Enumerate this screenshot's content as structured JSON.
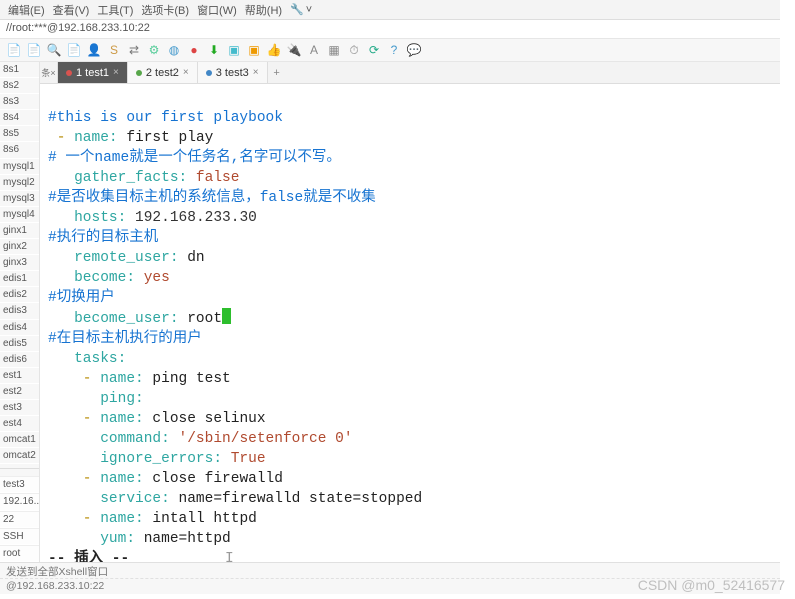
{
  "menubar": {
    "items": [
      "编辑(E)",
      "查看(V)",
      "工具(T)",
      "选项卡(B)",
      "窗口(W)",
      "帮助(H)"
    ],
    "wrench": "˅"
  },
  "address": "//root:***@192.168.233.10:22",
  "toolbar_icons": [
    {
      "name": "file",
      "g": "📄",
      "c": "#5a5"
    },
    {
      "name": "doc",
      "g": "📄",
      "c": "#888"
    },
    {
      "name": "search",
      "g": "🔍",
      "c": "#888"
    },
    {
      "name": "doc2",
      "g": "📄",
      "c": "#888"
    },
    {
      "name": "user",
      "g": "👤",
      "c": "#f39c12"
    },
    {
      "name": "script",
      "g": "S",
      "c": "#c94"
    },
    {
      "name": "arrows",
      "g": "⇄",
      "c": "#777"
    },
    {
      "name": "gear",
      "g": "⚙",
      "c": "#5c9"
    },
    {
      "name": "node",
      "g": "◍",
      "c": "#49c"
    },
    {
      "name": "red",
      "g": "●",
      "c": "#d44"
    },
    {
      "name": "dl",
      "g": "⬇",
      "c": "#2a2"
    },
    {
      "name": "blue",
      "g": "▣",
      "c": "#4bc"
    },
    {
      "name": "orange",
      "g": "▣",
      "c": "#e90"
    },
    {
      "name": "like",
      "g": "👍",
      "c": "#aaa"
    },
    {
      "name": "plug",
      "g": "🔌",
      "c": "#e80"
    },
    {
      "name": "text",
      "g": "A",
      "c": "#888"
    },
    {
      "name": "grid",
      "g": "▦",
      "c": "#888"
    },
    {
      "name": "clock",
      "g": "⏱",
      "c": "#888"
    },
    {
      "name": "ref",
      "g": "⟳",
      "c": "#2a8"
    },
    {
      "name": "help",
      "g": "?",
      "c": "#49c"
    },
    {
      "name": "chat",
      "g": "💬",
      "c": "#e80"
    }
  ],
  "sidebar": {
    "top_items": [
      "8s1",
      "8s2",
      "8s3",
      "8s4",
      "8s5",
      "8s6",
      "mysql1",
      "mysql2",
      "mysql3",
      "mysql4",
      "ginx1",
      "ginx2",
      "ginx3",
      "edis1",
      "edis2",
      "edis3",
      "edis4",
      "edis5",
      "edis6",
      "est1",
      "est2",
      "est3",
      "est4",
      "omcat1",
      "omcat2"
    ],
    "bottom_items": [
      "test3",
      "192.16...",
      "22",
      "SSH",
      "root"
    ]
  },
  "tabs": {
    "pre": "条×",
    "items": [
      {
        "dot": "red",
        "label": "1 test1",
        "active": true
      },
      {
        "dot": "green",
        "label": "2 test2",
        "active": false
      },
      {
        "dot": "blue",
        "label": "3 test3",
        "active": false
      }
    ]
  },
  "yaml": {
    "l01_comment": "#this is our first playbook",
    "l02_dash": " - ",
    "l02_key": "name:",
    "l02_val": " first play",
    "l03_comment": "# 一个name就是一个任务名,名字可以不写。",
    "l04_key": "   gather_facts:",
    "l04_val": " false",
    "l05_comment": "#是否收集目标主机的系统信息，false就是不收集",
    "l06_key": "   hosts:",
    "l06_val": " 192.168.233.30",
    "l07_comment": "#执行的目标主机",
    "l08_key": "   remote_user:",
    "l08_val": " dn",
    "l09_key": "   become:",
    "l09_val": " yes",
    "l10_comment": "#切换用户",
    "l11_key": "   become_user:",
    "l11_val": " root",
    "l12_comment": "#在目标主机执行的用户",
    "l13_key": "   tasks:",
    "l14_dash": "    - ",
    "l14_key": "name:",
    "l14_val": " ping test",
    "l15_key": "      ping:",
    "l16_dash": "    - ",
    "l16_key": "name:",
    "l16_val": " close selinux",
    "l17_key": "      command:",
    "l17_val": " '/sbin/setenforce 0'",
    "l18_key": "      ignore_errors:",
    "l18_val": " True",
    "l19_dash": "    - ",
    "l19_key": "name:",
    "l19_val": " close firewalld",
    "l20_key": "      service:",
    "l20_val": " name=firewalld state=stopped",
    "l21_dash": "    - ",
    "l21_key": "name:",
    "l21_val": " intall httpd",
    "l22_key": "      yum:",
    "l22_val": " name=httpd",
    "status": "-- 插入 --",
    "caret": "I"
  },
  "bottom_status": {
    "hint": "发送到全部Xshell窗口",
    "host": "@192.168.233.10:22"
  },
  "watermark": "CSDN @m0_52416577"
}
